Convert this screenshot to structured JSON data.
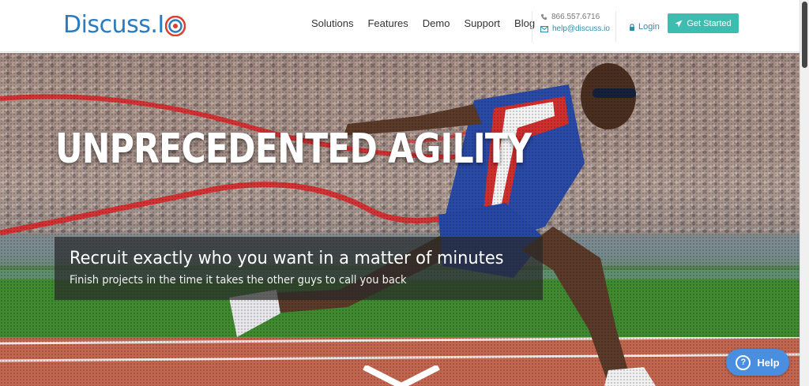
{
  "header": {
    "logo_text": "Discuss.I",
    "nav": [
      "Solutions",
      "Features",
      "Demo",
      "Support",
      "Blog"
    ],
    "phone": "866.557.6716",
    "email": "help@discuss.io",
    "login_label": "Login",
    "cta_label": "Get Started"
  },
  "hero": {
    "headline": "UNPRECEDENTED AGILITY",
    "tagline": "Recruit exactly who you want in a matter of minutes",
    "subtagline": "Finish projects in the time it takes the other guys to call you back"
  },
  "help": {
    "label": "Help"
  },
  "colors": {
    "brand": "#2a7bbf",
    "accent": "#3dbdb0",
    "link": "#2c8fb0",
    "help": "#4a8ee0"
  }
}
